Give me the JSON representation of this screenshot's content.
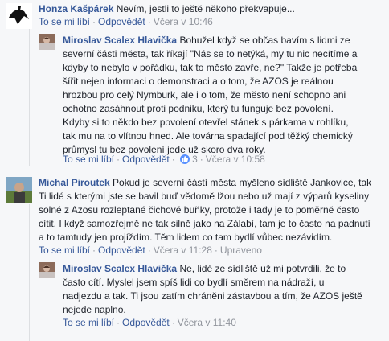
{
  "comments": [
    {
      "author": "Honza Kašpárek",
      "text": "Nevím, jestli to ještě někoho překvapuje...",
      "actions": {
        "like": "To se mi líbí",
        "reply": "Odpovědět",
        "time": "Včera v 10:46"
      }
    },
    {
      "author": "Miroslav Scalex Hlavička",
      "lines": [
        "Bohužel když se občas bavím s lidmi ze",
        "severní části města, tak říkají \"Nás se to netýká, my tu nic necítíme a",
        "kdyby to nebylo v pořádku, tak to město zavře, ne?\" Takže je potřeba",
        "šířit nejen informaci o demonstraci a o tom, že AZOS je reálnou",
        "hrozbou pro celý Nymburk, ale i o tom, že město není schopno ani",
        "ochotno zasáhnout proti podniku, který tu funguje bez povolení.",
        "Kdyby si to někdo bez povolení otevřel stánek s párkama v rohlíku,",
        "tak mu na to vlítnou hned. Ale továrna spadající pod těžký chemický",
        "průmysl tu bez povolení jede už skoro dva roky."
      ],
      "actions": {
        "like": "To se mi líbí",
        "reply": "Odpovědět",
        "likes": "3",
        "time": "Včera v 10:58"
      }
    },
    {
      "author": "Michal Piroutek",
      "lines": [
        "Pokud je severní částí města myšleno sídliště Jankovice, tak",
        "Ti lidé s kterými jste se bavil buď vědomě lžou nebo už mají z výparů kyseliny",
        "solné z Azosu rozleptané čichové buňky, protože i tady je to poměrně často",
        "cítit. I když samozřejmě ne tak silně jako na Zálabí, tam je to často na padnutí",
        "a to tamtudy jen projíždím. Těm lidem co tam bydlí vůbec nezávidím."
      ],
      "actions": {
        "like": "To se mi líbí",
        "reply": "Odpovědět",
        "time": "Včera v 11:28",
        "edited": "Upraveno"
      }
    },
    {
      "author": "Miroslav Scalex Hlavička",
      "lines": [
        "Ne, lidé ze sídliště už mi potvrdili, že to",
        "často cítí. Myslel jsem spíš lidi co bydlí směrem na nádraží, u",
        "nadjezdu a tak. Ti jsou zatím chráněni zástavbou a tím, že AZOS ještě",
        "nejede naplno."
      ],
      "actions": {
        "like": "To se mi líbí",
        "reply": "Odpovědět",
        "time": "Včera v 11:40"
      }
    }
  ],
  "colors": {
    "link": "#365899",
    "meta": "#90949c",
    "background": "#f6f7f9",
    "like_badge": "#5890ff"
  }
}
